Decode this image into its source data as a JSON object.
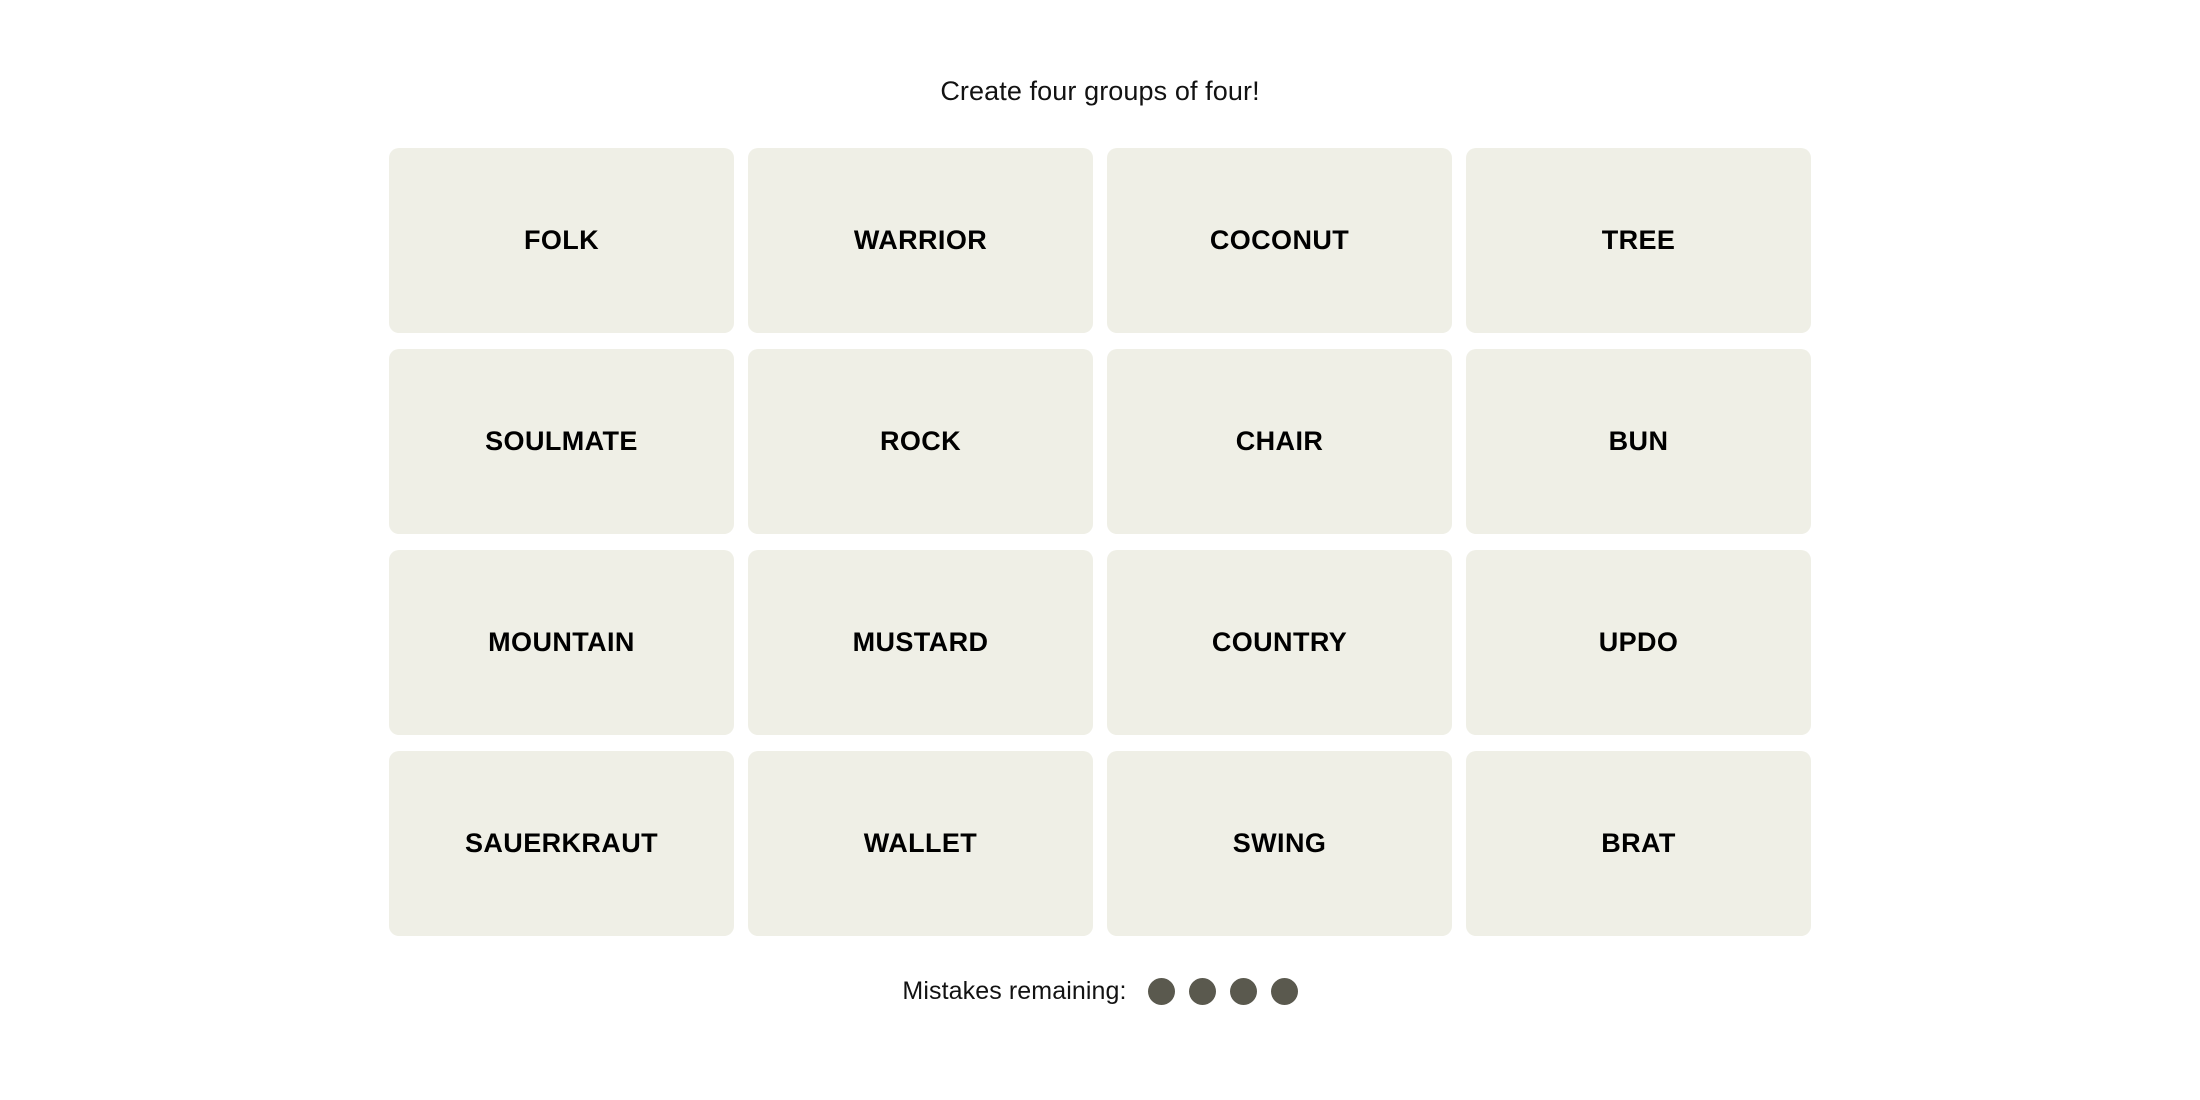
{
  "game": {
    "instruction": "Create four groups of four!",
    "tiles": [
      {
        "label": "FOLK"
      },
      {
        "label": "WARRIOR"
      },
      {
        "label": "COCONUT"
      },
      {
        "label": "TREE"
      },
      {
        "label": "SOULMATE"
      },
      {
        "label": "ROCK"
      },
      {
        "label": "CHAIR"
      },
      {
        "label": "BUN"
      },
      {
        "label": "MOUNTAIN"
      },
      {
        "label": "MUSTARD"
      },
      {
        "label": "COUNTRY"
      },
      {
        "label": "UPDO"
      },
      {
        "label": "SAUERKRAUT"
      },
      {
        "label": "WALLET"
      },
      {
        "label": "SWING"
      },
      {
        "label": "BRAT"
      }
    ],
    "mistakes": {
      "label": "Mistakes remaining:",
      "remaining": 4,
      "total": 4,
      "dot_color": "#5a594e"
    },
    "colors": {
      "page_background": "#ffffff",
      "tile_background": "#efefe6",
      "tile_text": "#000000",
      "instruction_text": "#121212"
    }
  }
}
